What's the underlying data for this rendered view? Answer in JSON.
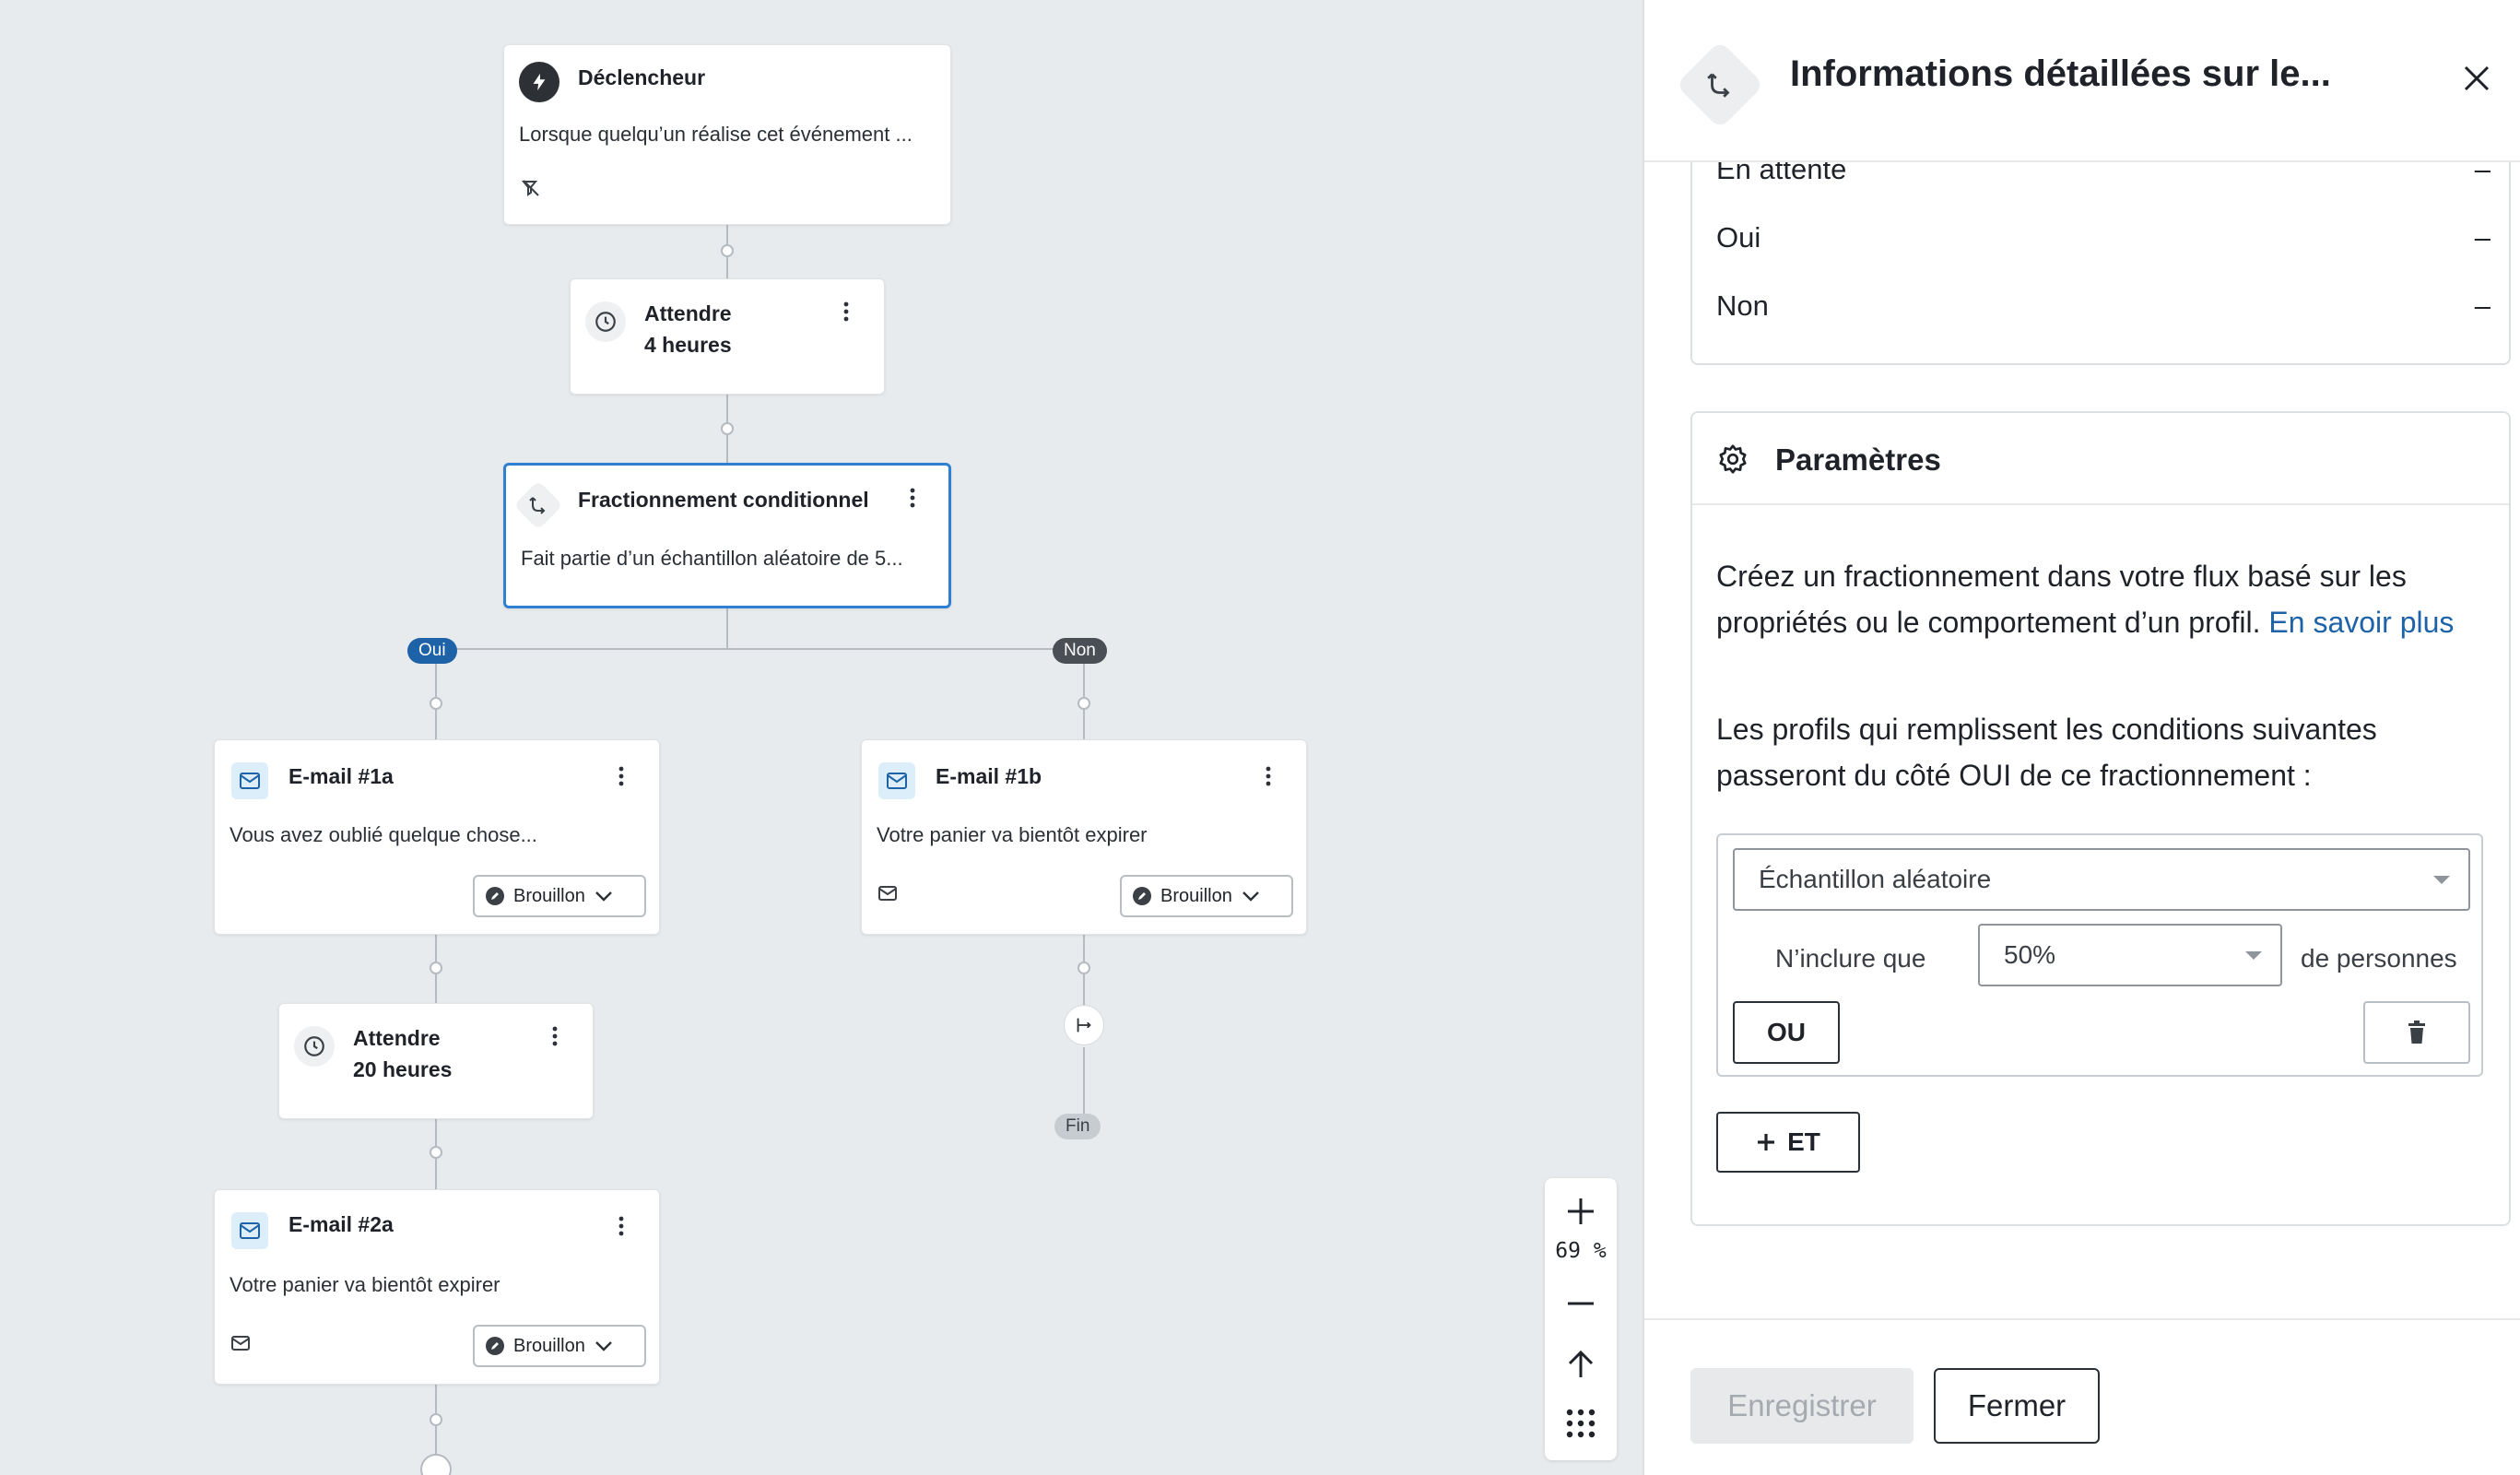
{
  "canvas": {
    "trigger": {
      "title": "Déclencheur",
      "description": "Lorsque quelqu’un réalise cet événement ..."
    },
    "wait1": {
      "title": "Attendre",
      "duration": "4 heures"
    },
    "split": {
      "title": "Fractionnement conditionnel",
      "description": "Fait partie d’un échantillon aléatoire de 5..."
    },
    "branch_yes": "Oui",
    "branch_no": "Non",
    "email1a": {
      "title": "E-mail #1a",
      "subject": "Vous avez oublié quelque chose...",
      "status": "Brouillon"
    },
    "email1b": {
      "title": "E-mail #1b",
      "subject": "Votre panier va bientôt expirer",
      "status": "Brouillon"
    },
    "wait2": {
      "title": "Attendre",
      "duration": "20 heures"
    },
    "email2a": {
      "title": "E-mail #2a",
      "subject": "Votre panier va bientôt expirer",
      "status": "Brouillon"
    },
    "end_label": "Fin",
    "zoom": {
      "level": "69 %"
    }
  },
  "panel": {
    "title": "Informations détaillées sur le...",
    "stats": [
      {
        "label": "En attente",
        "value": "–"
      },
      {
        "label": "Oui",
        "value": "–"
      },
      {
        "label": "Non",
        "value": "–"
      }
    ],
    "settings": {
      "title": "Paramètres",
      "intro": "Créez un fractionnement dans votre flux basé sur les propriétés ou le comportement d’un profil.",
      "learn_more": "En savoir plus",
      "instruction": "Les profils qui remplissent les conditions suivantes passeront du côté OUI de ce fractionnement :",
      "condition_type": "Échantillon aléatoire",
      "include_label": "N’inclure que",
      "percent": "50%",
      "persons_label": "de personnes",
      "or_label": "OU",
      "and_label": "ET"
    },
    "footer": {
      "save": "Enregistrer",
      "close": "Fermer"
    }
  },
  "colors": {
    "accent": "#1e63a8",
    "selected_border": "#2f7fd3",
    "canvas_bg": "#e8ebed"
  }
}
